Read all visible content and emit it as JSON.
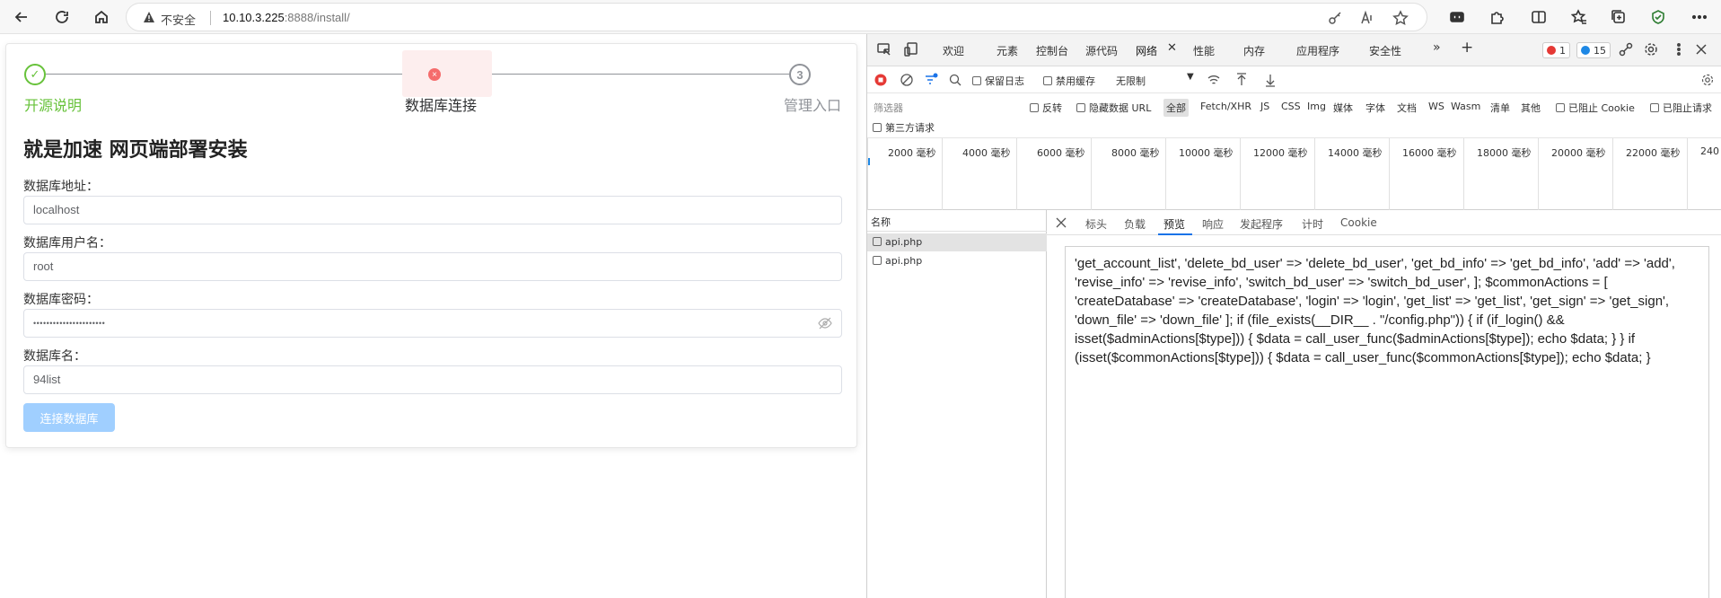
{
  "browser": {
    "insecure_label": "不安全",
    "url_host": "10.10.3.225",
    "url_rest": ":8888/install/"
  },
  "install": {
    "steps": [
      {
        "label": "开源说明",
        "marker": "✓"
      },
      {
        "label": "数据库连接",
        "marker": "×"
      },
      {
        "label": "管理入口",
        "marker": "3"
      }
    ],
    "title": "就是加速 网页端部署安装",
    "fields": [
      {
        "label": "数据库地址：",
        "value": "localhost"
      },
      {
        "label": "数据库用户名：",
        "value": "root"
      },
      {
        "label": "数据库密码：",
        "value": "••••••••••••••••••••••"
      },
      {
        "label": "数据库名：",
        "value": "94list"
      }
    ],
    "connect_button": "连接数据库"
  },
  "devtools": {
    "tabs": [
      "欢迎",
      "元素",
      "控制台",
      "源代码",
      "网络",
      "性能",
      "内存",
      "应用程序",
      "安全性"
    ],
    "error_count": "1",
    "message_count": "15",
    "preserve_log": "保留日志",
    "disable_cache": "禁用缓存",
    "throttle": "无限制",
    "filter_placeholder": "筛选器",
    "invert": "反转",
    "hide_data_url": "隐藏数据 URL",
    "type_filters": [
      "全部",
      "Fetch/XHR",
      "JS",
      "CSS",
      "Img",
      "媒体",
      "字体",
      "文档",
      "WS",
      "Wasm",
      "清单",
      "其他"
    ],
    "blocked_cookies": "已阻止 Cookie",
    "blocked_requests": "已阻止请求",
    "third_party": "第三方请求",
    "timeline_labels": [
      "2000 毫秒",
      "4000 毫秒",
      "6000 毫秒",
      "8000 毫秒",
      "10000 毫秒",
      "12000 毫秒",
      "14000 毫秒",
      "16000 毫秒",
      "18000 毫秒",
      "20000 毫秒",
      "22000 毫秒",
      "240"
    ],
    "name_header": "名称",
    "requests": [
      "api.php",
      "api.php"
    ],
    "detail_tabs": [
      "标头",
      "负载",
      "预览",
      "响应",
      "发起程序",
      "计时",
      "Cookie"
    ],
    "preview_text": "'get_account_list', 'delete_bd_user' => 'delete_bd_user', 'get_bd_info' => 'get_bd_info', 'add' => 'add', 'revise_info' => 'revise_info', 'switch_bd_user' => 'switch_bd_user', ]; $commonActions = [ 'createDatabase' => 'createDatabase', 'login' => 'login', 'get_list' => 'get_list', 'get_sign' => 'get_sign', 'down_file' => 'down_file' ]; if (file_exists(__DIR__ . \"/config.php\")) { if (if_login() && isset($adminActions[$type])) { $data = call_user_func($adminActions[$type]); echo $data; } } if (isset($commonActions[$type])) { $data = call_user_func($commonActions[$type]); echo $data; }"
  }
}
